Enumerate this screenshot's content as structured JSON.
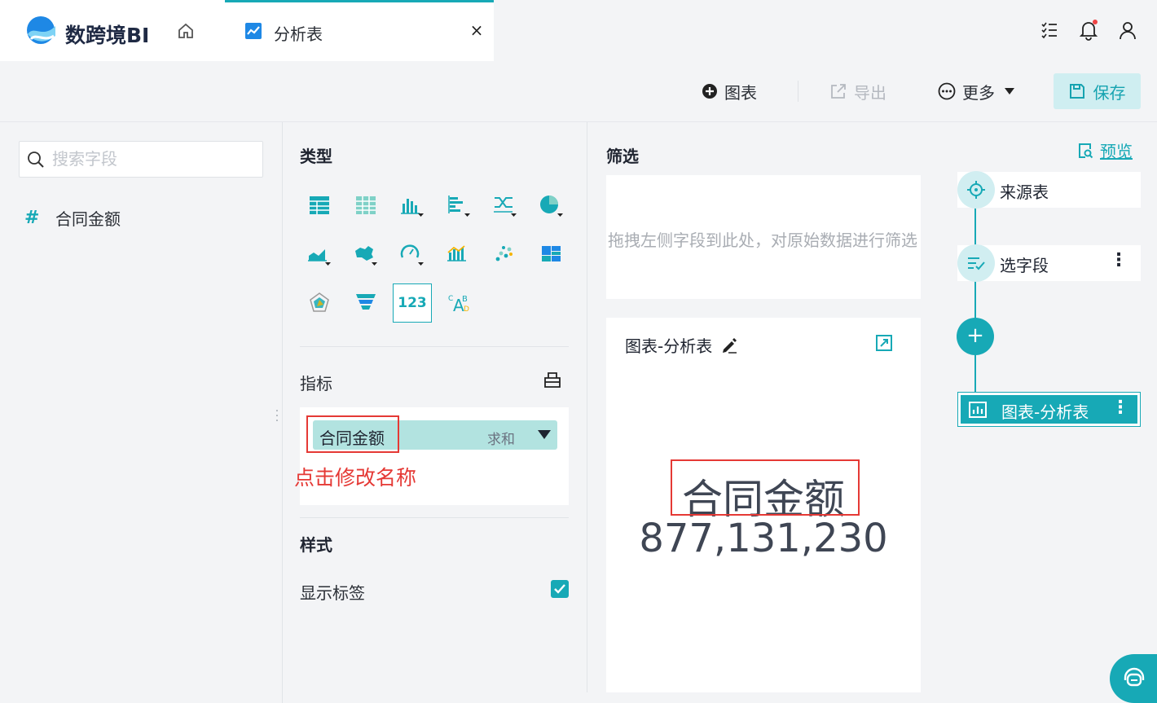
{
  "app": {
    "brand": "数跨境BI",
    "tab_label": "分析表",
    "tab_close": "×"
  },
  "toolbar": {
    "chart": "图表",
    "export": "导出",
    "more": "更多",
    "save": "保存"
  },
  "fields": {
    "search_placeholder": "搜索字段",
    "items": [
      {
        "symbol": "#",
        "name": "合同金额"
      }
    ]
  },
  "panel": {
    "type_title": "类型",
    "metric_title": "指标",
    "metric_pill": {
      "name": "合同金额",
      "aggregation": "求和"
    },
    "annotation": "点击修改名称",
    "style_title": "样式",
    "show_label": "显示标签",
    "show_label_checked": true,
    "chart_types": [
      "table-icon",
      "detail-table-icon",
      "bar-chart-icon",
      "horizontal-bar-icon",
      "combo-icon",
      "pie-chart-icon",
      "area-chart-icon",
      "map-icon",
      "gauge-icon",
      "combo-bar-icon",
      "scatter-icon",
      "treemap-icon",
      "radar-icon",
      "funnel-icon",
      "kpi-number-icon",
      "word-cloud-icon"
    ],
    "kpi_label": "123",
    "word_cloud_label": "ABC"
  },
  "filter": {
    "title": "筛选",
    "hint": "拖拽左侧字段到此处，对原始数据进行筛选"
  },
  "card": {
    "title": "图表-分析表",
    "kpi_name": "合同金额",
    "kpi_value": "877,131,230"
  },
  "flow": {
    "preview": "预览",
    "nodes": [
      {
        "label": "来源表"
      },
      {
        "label": "选字段",
        "menu": "⋮"
      }
    ],
    "add": "+",
    "chart_node": {
      "label": "图表-分析表",
      "menu": "⋮"
    }
  },
  "colors": {
    "accent": "#17a9b6",
    "annotation": "#e53935"
  }
}
